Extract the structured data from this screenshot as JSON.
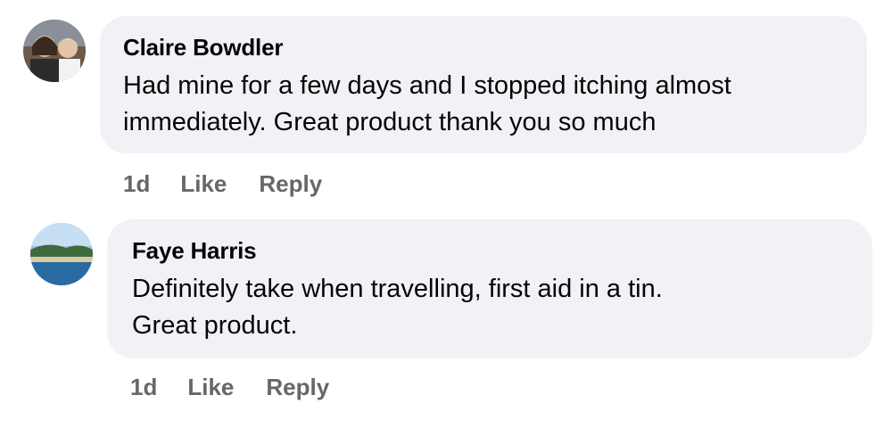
{
  "comments": [
    {
      "author": "Claire Bowdler",
      "lines": [
        "Had mine for a few days and I stopped itching almost",
        "immediately. Great product thank you so much"
      ],
      "time": "1d",
      "like_label": "Like",
      "reply_label": "Reply"
    },
    {
      "author": "Faye Harris",
      "lines": [
        "Definitely take when travelling, first aid in a tin.",
        "Great product."
      ],
      "time": "1d",
      "like_label": "Like",
      "reply_label": "Reply"
    }
  ],
  "colors": {
    "bubble": "#f0f2f5",
    "text": "#050505",
    "meta": "#65676b"
  }
}
